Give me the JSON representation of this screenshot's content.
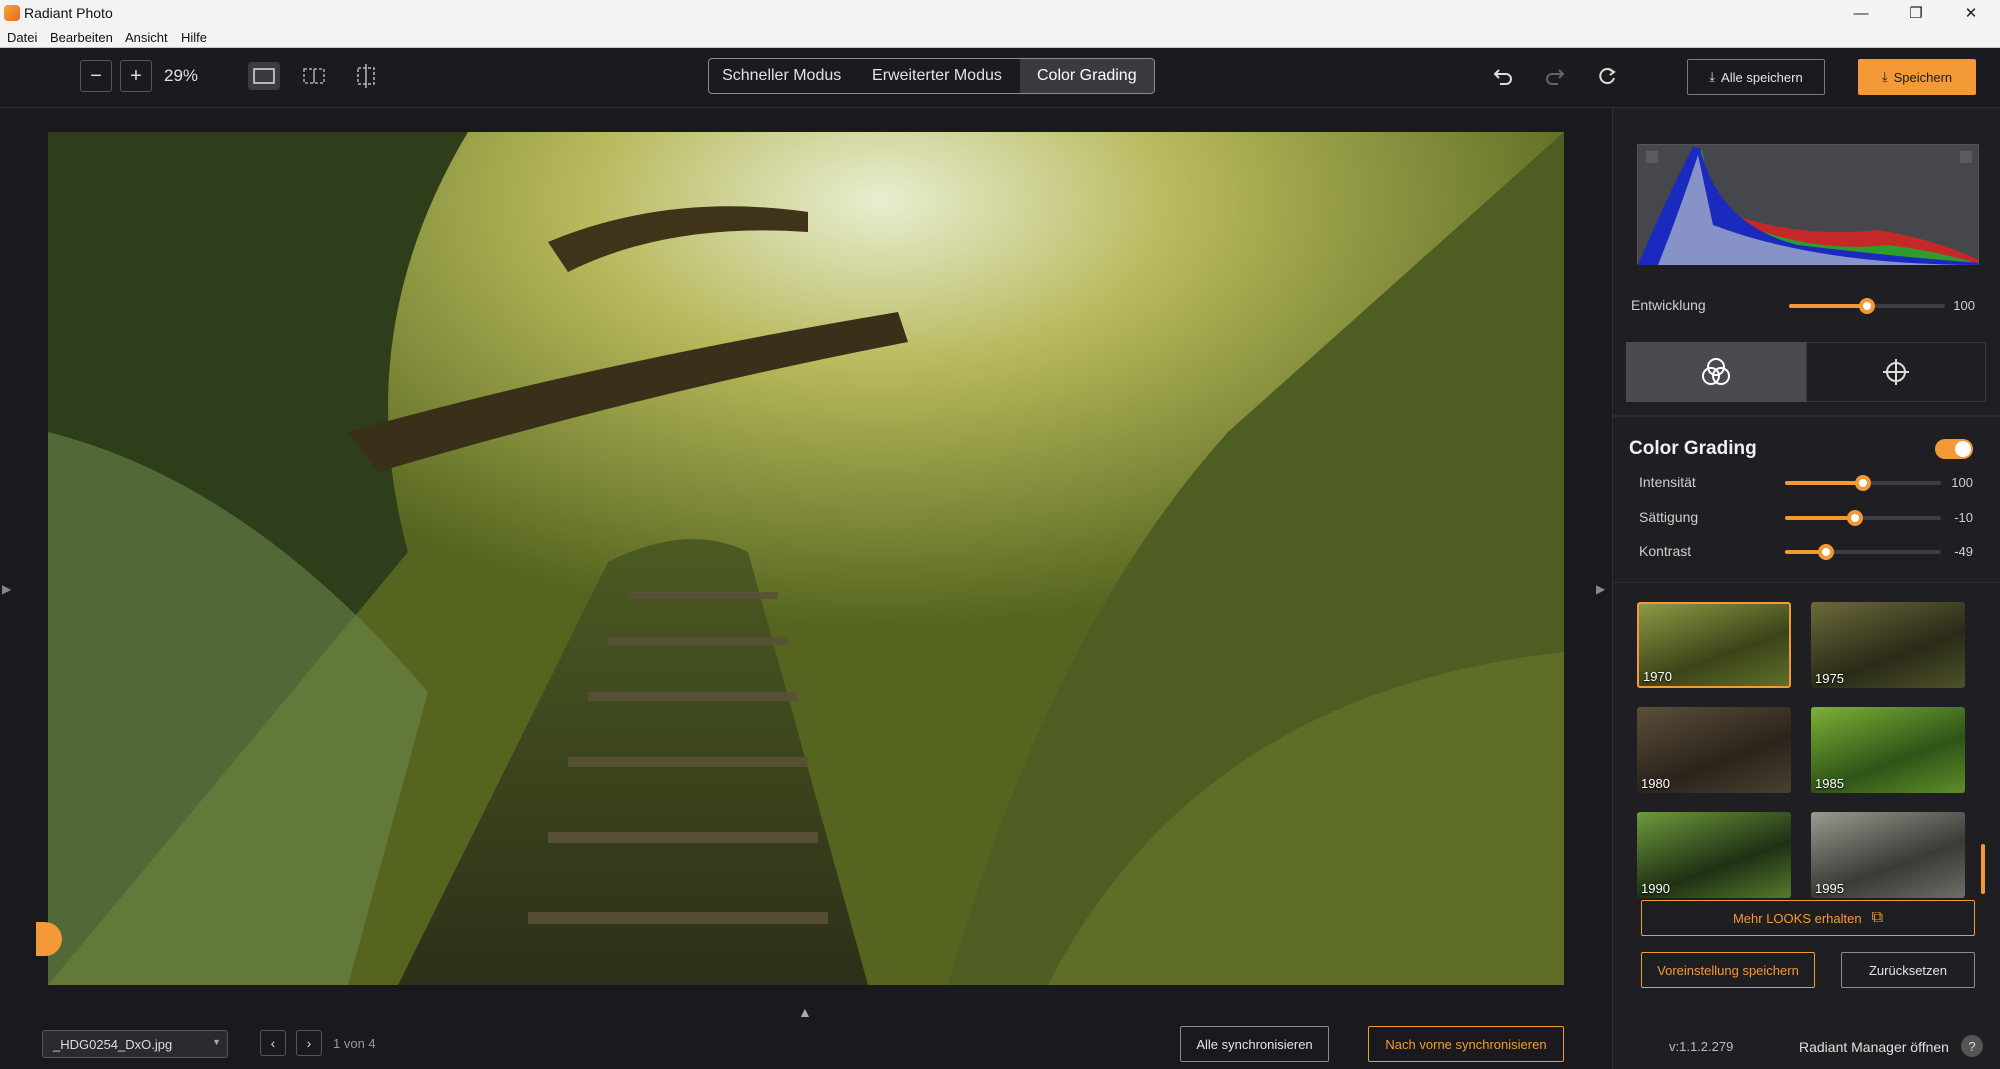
{
  "window": {
    "title": "Radiant Photo",
    "minimize": "—",
    "maximize": "❐",
    "close": "✕"
  },
  "menu": [
    "Datei",
    "Bearbeiten",
    "Ansicht",
    "Hilfe"
  ],
  "toolbar": {
    "zoom_out": "−",
    "zoom_in": "+",
    "zoom": "29%",
    "modes": [
      "Schneller Modus",
      "Erweiterter Modus",
      "Color Grading"
    ],
    "save_all": "Alle speichern",
    "save": "Speichern"
  },
  "panel": {
    "entwicklung": {
      "label": "Entwicklung",
      "value": "100",
      "fraction": 0.5
    },
    "section_title": "Color Grading",
    "sliders": [
      {
        "label": "Intensität",
        "value": "100",
        "fraction": 0.5
      },
      {
        "label": "Sättigung",
        "value": "-10",
        "fraction": 0.45
      },
      {
        "label": "Kontrast",
        "value": "-49",
        "fraction": 0.26
      }
    ],
    "looks": [
      "1970",
      "1975",
      "1980",
      "1985",
      "1990",
      "1995"
    ],
    "more_looks": "Mehr LOOKS erhalten",
    "save_preset": "Voreinstellung speichern",
    "reset": "Zurücksetzen",
    "version": "v:1.1.2.279",
    "manager": "Radiant Manager öffnen",
    "help": "?"
  },
  "footer": {
    "filename": "_HDG0254_DxO.jpg",
    "page": "1 von 4",
    "sync_all": "Alle synchronisieren",
    "sync_forward": "Nach vorne synchronisieren"
  },
  "colors": {
    "accent": "#f39a36",
    "bg": "#1c1c20"
  }
}
